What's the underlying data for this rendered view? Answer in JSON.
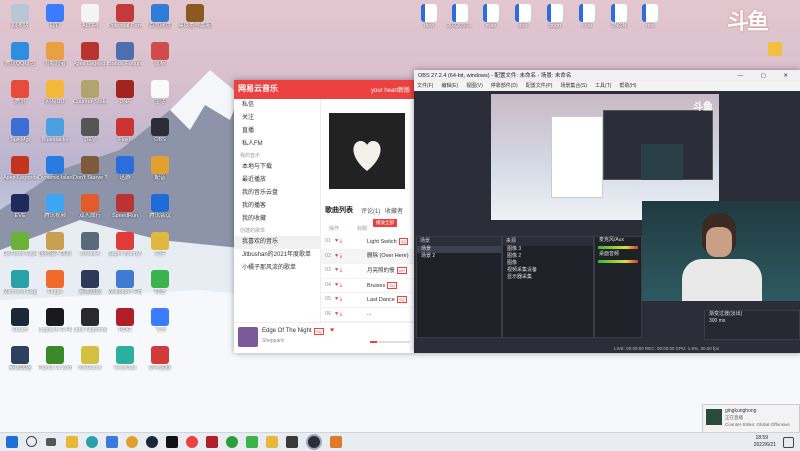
{
  "desktop_icons": [
    {
      "label": "回收站",
      "color": "#b9c6d6"
    },
    {
      "label": "钉钉",
      "color": "#3a7bff"
    },
    {
      "label": "ALTF4",
      "color": "#f4f4f4"
    },
    {
      "label": "Potential Party",
      "color": "#c43a3a"
    },
    {
      "label": "百度网盘",
      "color": "#2f7dd7"
    },
    {
      "label": "模以类与最新版本2D功能",
      "color": "#8a5a20"
    },
    {
      "label": "腾讯QQ绿色",
      "color": "#2f8ee0"
    },
    {
      "label": "火影忍者",
      "color": "#e8a040"
    },
    {
      "label": "Apex Legends",
      "color": "#b8342f"
    },
    {
      "label": "Bonds Fortune",
      "color": "#4d6fb0"
    },
    {
      "label": "鼠标",
      "color": "#d24b4b"
    },
    {
      "label": "腾讯",
      "color": "#e64b3c"
    },
    {
      "label": "网易UU",
      "color": "#f4b83a"
    },
    {
      "label": "Counter-Strike",
      "color": "#b3a36f"
    },
    {
      "label": "DNF",
      "color": "#a3231e"
    },
    {
      "label": "生活",
      "color": "#fafafa"
    },
    {
      "label": "TaskMgr",
      "color": "#3b6fd6"
    },
    {
      "label": "Bluestacks",
      "color": "#4aa0e0"
    },
    {
      "label": "DEV",
      "color": "#555555"
    },
    {
      "label": "Flash",
      "color": "#c33"
    },
    {
      "label": "OBS",
      "color": "#2b2e38"
    },
    {
      "label": "Apex Legends",
      "color": "#c3341f"
    },
    {
      "label": "Dynamic Island",
      "color": "#2a7be0"
    },
    {
      "label": "Don't Starve Together",
      "color": "#7d5a3a"
    },
    {
      "label": "迅游",
      "color": "#2b6edb"
    },
    {
      "label": "配音",
      "color": "#e0a130"
    },
    {
      "label": "EVE",
      "color": "#1d2a5a"
    },
    {
      "label": "腾讯视频",
      "color": "#3ca5f5"
    },
    {
      "label": "双人成行",
      "color": "#e35b2a"
    },
    {
      "label": "SpeedRun",
      "color": "#b33"
    },
    {
      "label": "腾讯会议",
      "color": "#1e6dd7"
    },
    {
      "label": "GeForce Experience",
      "color": "#6ab23a"
    },
    {
      "label": "怪物猎人世界",
      "color": "#c8a050"
    },
    {
      "label": "Unravel",
      "color": "#5a6a7a"
    },
    {
      "label": "Super Bunny Man",
      "color": "#e03a3a"
    },
    {
      "label": "文件",
      "color": "#e0b840"
    },
    {
      "label": "Microsoft Edge",
      "color": "#2aa0a8"
    },
    {
      "label": "Origin",
      "color": "#f06a2a"
    },
    {
      "label": "英雄联盟",
      "color": "#2d3a5a"
    },
    {
      "label": "Wallpaper Engine",
      "color": "#3f7ad4"
    },
    {
      "label": "微信",
      "color": "#3ab34a"
    },
    {
      "label": "Steam",
      "color": "#1b2838"
    },
    {
      "label": "Logitech G HUB",
      "color": "#1a1a1a"
    },
    {
      "label": "Little Nightmares",
      "color": "#2a2a2a"
    },
    {
      "label": "ROG",
      "color": "#b01e2a"
    },
    {
      "label": "飞书",
      "color": "#3a7bff"
    },
    {
      "label": "英雄联盟",
      "color": "#2e4060"
    },
    {
      "label": "Plants vs Zombies",
      "color": "#3a8a2a"
    },
    {
      "label": "WeGame",
      "color": "#d4c040"
    },
    {
      "label": "VeryKuai",
      "color": "#2bb0a0"
    },
    {
      "label": "剑与远征",
      "color": "#d23a3a"
    }
  ],
  "top_files": [
    {
      "label": "dew",
      "color": "#2b6edb"
    },
    {
      "label": "2022050...",
      "color": "#2b6edb"
    },
    {
      "label": "mae",
      "color": "#2b6edb"
    },
    {
      "label": "dnu",
      "color": "#2b6edb"
    },
    {
      "label": "gogo",
      "color": "#2b6edb"
    },
    {
      "label": "ccai",
      "color": "#2b6edb"
    },
    {
      "label": "0NON",
      "color": "#2b6edb"
    },
    {
      "label": "nnt",
      "color": "#2b6edb"
    }
  ],
  "corner_logo": "斗鱼",
  "netease": {
    "app_name": "网易云音乐",
    "search_hint": "your heart新版",
    "nav": [
      "私信",
      "关注",
      "直播",
      "私人FM"
    ],
    "section_my": "我的音乐",
    "my_items": [
      "本地与下载",
      "最近播放",
      "我的音乐云盘",
      "我的播客",
      "我的收藏"
    ],
    "section_created": "创建的歌单",
    "playlists": [
      "我喜欢的音乐",
      "Jitbushan的2021年度歌单",
      "小橘子那风流的歌单"
    ],
    "tab_active": "歌曲列表",
    "tab_comments": "评论(1)",
    "tab_fans": "收藏者",
    "col_op": "操作",
    "col_title": "标题",
    "play_all": "播放全部",
    "songs": [
      {
        "n": "01",
        "title": "Light Switch",
        "tag": "SQ"
      },
      {
        "n": "02",
        "title": "删除 (Over Here)",
        "tag": ""
      },
      {
        "n": "03",
        "title": "月亮照的慢",
        "tag": "VIP"
      },
      {
        "n": "04",
        "title": "Bruises",
        "tag": "SQ"
      },
      {
        "n": "05",
        "title": "Last Dance",
        "tag": "SQ"
      },
      {
        "n": "06",
        "title": "...",
        "tag": ""
      }
    ],
    "now_playing_title": "Edge Of The Night",
    "now_playing_artist": "Sheppard",
    "song_badge": "SQ"
  },
  "obs": {
    "title": "OBS 27.2.4 (64-bit, windows) - 配置文件: 未命名 - 场景: 未命名",
    "menu": [
      "文件(F)",
      "编辑(E)",
      "视图(V)",
      "停靠部件(D)",
      "配置文件(P)",
      "场景集合(S)",
      "工具(T)",
      "帮助(H)"
    ],
    "scenes_header": "场景",
    "scenes": [
      "场景",
      "场景 2"
    ],
    "sources_header": "来源",
    "sources": [
      "图像 3",
      "图像 2",
      "图像",
      "视频采集设备",
      "显示器采集"
    ],
    "mixer_labels": [
      "麦克风/Aux",
      "桌面音频"
    ],
    "controls_header": "控制",
    "controls": [
      "开始推流",
      "开始录制",
      "工作室模式",
      "设置",
      "退出"
    ],
    "transition_label": "渐变过渡(淡出)",
    "duration": "300 ms",
    "status": "LIVE: 00:00:00   REC: 00:00:00   CPU: 1.9%, 30.00 fps"
  },
  "notification": {
    "title": "gingkunghong",
    "subtitle": "正在直播",
    "body": "Counter-Strike: Global Offensive"
  },
  "clock": {
    "time": "18:59",
    "date": "2022/6/21"
  }
}
